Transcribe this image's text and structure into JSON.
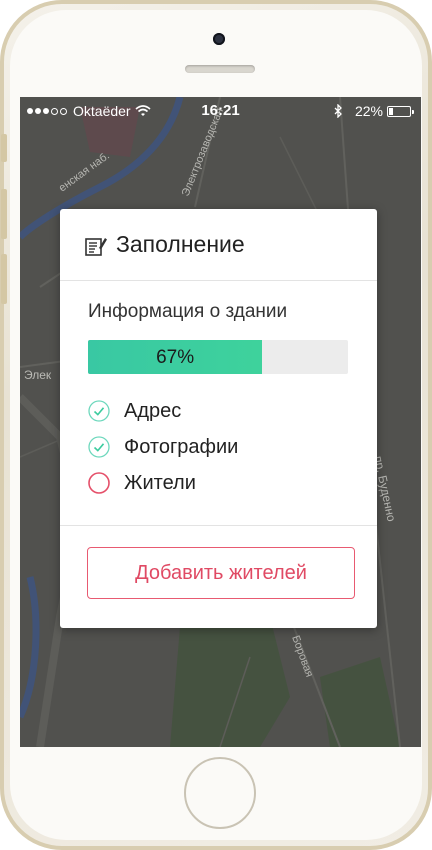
{
  "status_bar": {
    "carrier": "Oktaëder",
    "time": "16:21",
    "battery": "22%",
    "battery_level": 0.22
  },
  "map": {
    "street_labels": [
      "енская наб.",
      "Электрозаводская",
      "Элек",
      "пр. Буденно",
      "Боровая"
    ]
  },
  "card": {
    "title": "Заполнение",
    "section_title": "Информация о здании",
    "progress": {
      "label": "67%",
      "value": 0.67
    },
    "items": [
      {
        "label": "Адрес",
        "state": "done"
      },
      {
        "label": "Фотографии",
        "state": "done"
      },
      {
        "label": "Жители",
        "state": "pending"
      }
    ],
    "add_button": "Добавить жителей"
  },
  "colors": {
    "accent_green": "#3ccc9f",
    "accent_red": "#e85a71",
    "map_base": "#5b5b57"
  },
  "icons": [
    "signal-dots-icon",
    "wifi-icon",
    "bluetooth-icon",
    "battery-icon",
    "edit-note-icon",
    "check-circle-icon",
    "empty-circle-icon"
  ]
}
